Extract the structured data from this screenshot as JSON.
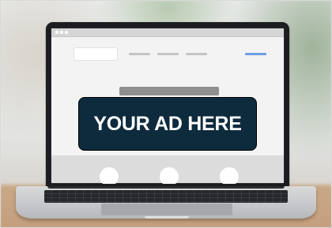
{
  "advertisement": {
    "text": "YOUR AD HERE",
    "background_color": "#0e2b3e",
    "text_color": "#ffffff"
  },
  "mock_website": {
    "window_controls": [
      "dot",
      "dot",
      "dot"
    ],
    "nav_cta_color": "#6d9ee2",
    "placeholder_circles": 3
  },
  "device": {
    "type": "laptop",
    "lid_color": "#1c1d20",
    "body_color": "#c9cacd"
  }
}
